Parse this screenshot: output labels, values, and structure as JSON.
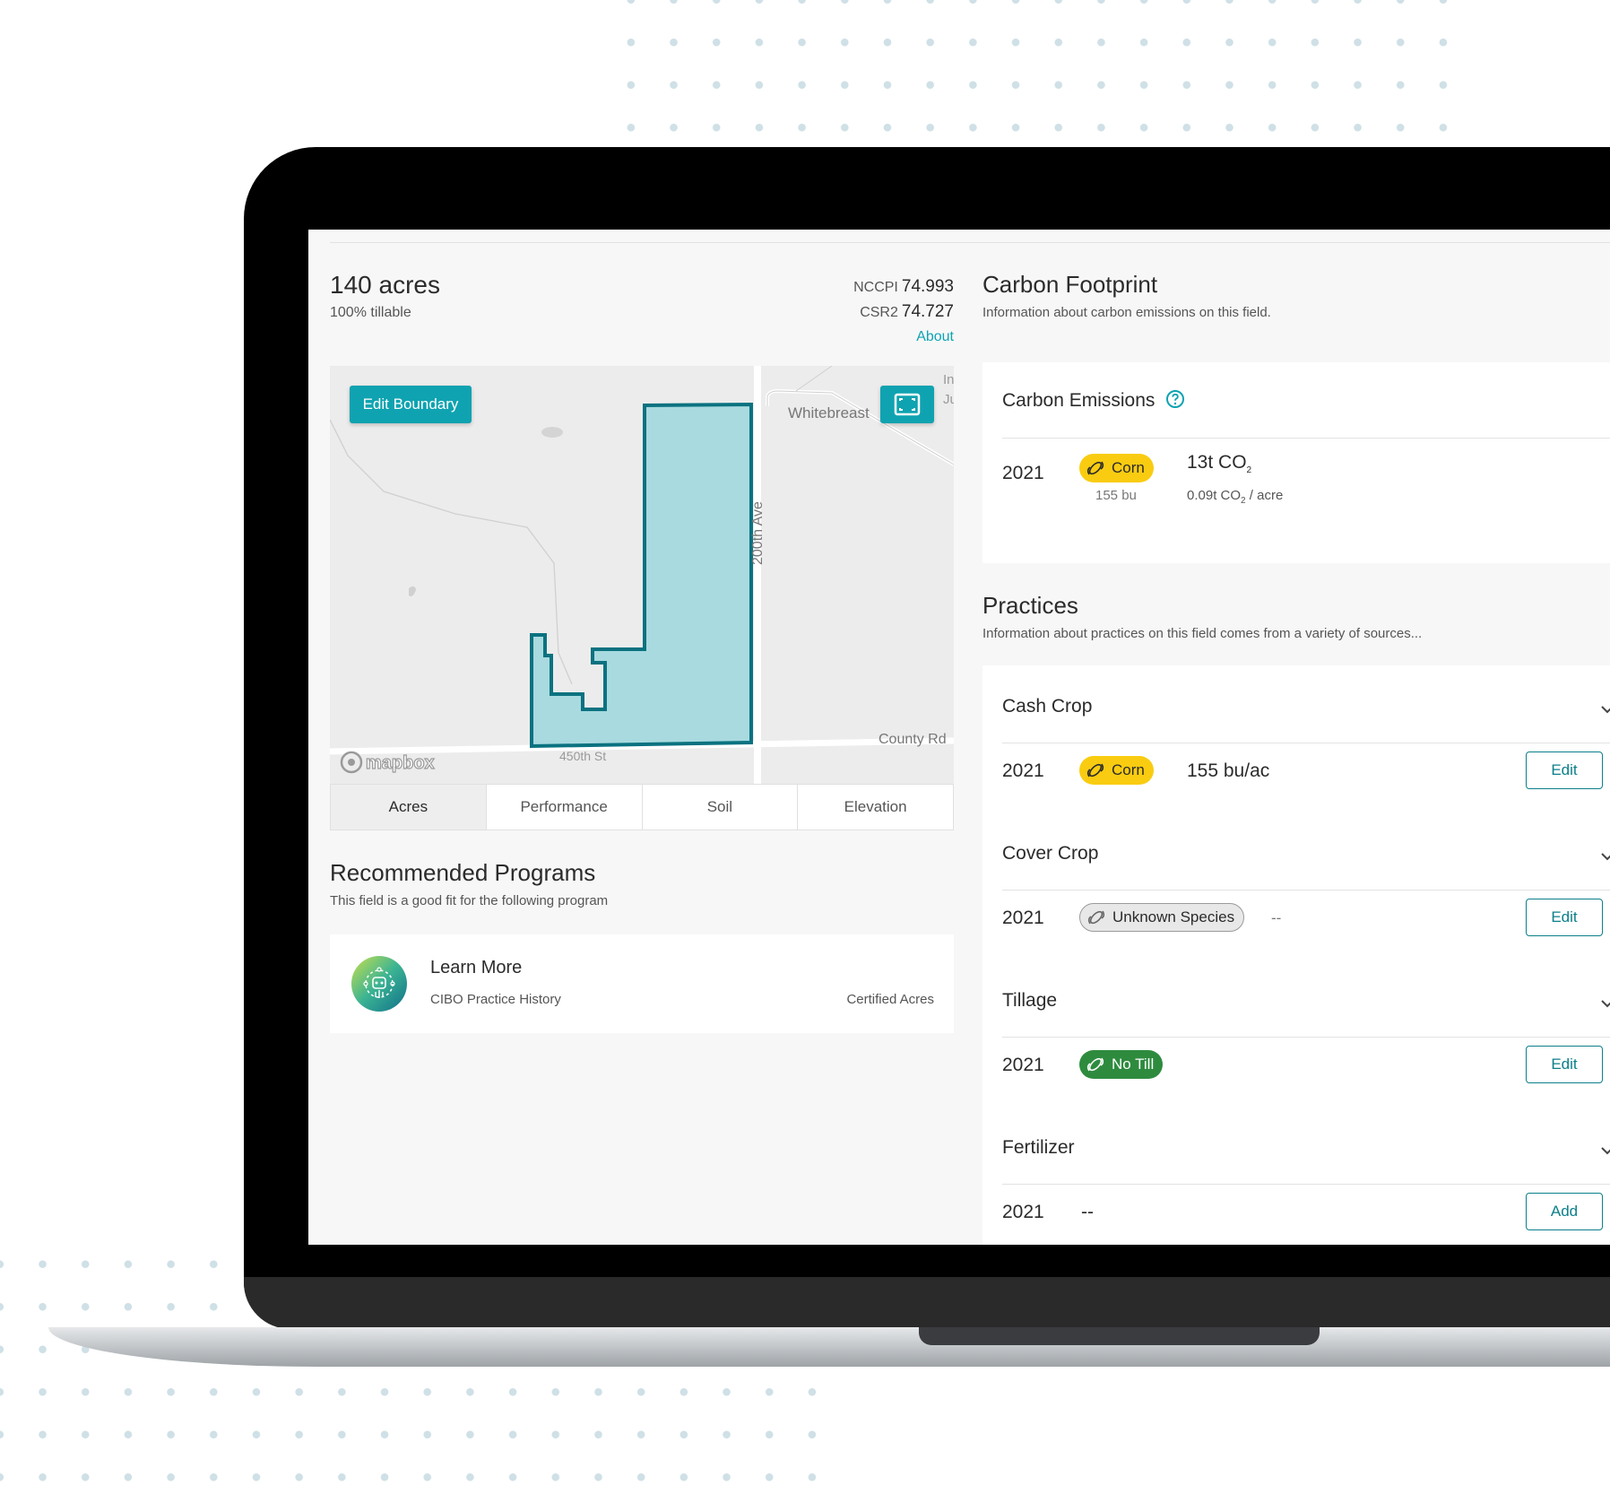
{
  "field": {
    "acres": "140 acres",
    "tillable": "100% tillable",
    "nccpi_label": "NCCPI",
    "nccpi_value": "74.993",
    "csr2_label": "CSR2",
    "csr2_value": "74.727",
    "about_link": "About"
  },
  "map": {
    "edit_boundary_label": "Edit Boundary",
    "road_whitebreast": "Whitebreast",
    "road_200th": "200th Ave",
    "road_county": "County Rd",
    "road_450th": "450th St",
    "road_in": "In",
    "road_ju": "Ju",
    "attribution": "mapbox",
    "fill_color": "#a8dadf",
    "stroke_color": "#0b7280"
  },
  "tabs": [
    {
      "label": "Acres",
      "active": true
    },
    {
      "label": "Performance",
      "active": false
    },
    {
      "label": "Soil",
      "active": false
    },
    {
      "label": "Elevation",
      "active": false
    }
  ],
  "recommended": {
    "title": "Recommended Programs",
    "subtitle": "This field is a good fit for the following program",
    "program": {
      "name": "Learn More",
      "subtitle": "CIBO Practice History",
      "tag": "Certified Acres"
    }
  },
  "carbon": {
    "title": "Carbon Footprint",
    "subtitle": "Information about carbon emissions on this field.",
    "emissions": {
      "heading": "Carbon Emissions",
      "year": "2021",
      "crop": "Corn",
      "yield": "155 bu",
      "total": "13t CO",
      "total_sub": "2",
      "per_acre": "0.09t CO",
      "per_acre_sub": "2",
      "per_acre_unit": "/ acre"
    }
  },
  "practices": {
    "title": "Practices",
    "subtitle": "Information about practices on this field comes from a variety of sources...",
    "items": [
      {
        "name": "Cash Crop",
        "year": "2021",
        "pill": "Corn",
        "value": "155 bu/ac",
        "action": "Edit"
      },
      {
        "name": "Cover Crop",
        "year": "2021",
        "pill": "Unknown Species",
        "value": "--",
        "action": "Edit"
      },
      {
        "name": "Tillage",
        "year": "2021",
        "pill": "No Till",
        "value": "",
        "action": "Edit"
      },
      {
        "name": "Fertilizer",
        "year": "2021",
        "pill": "",
        "value": "--",
        "action": "Add"
      }
    ]
  },
  "colors": {
    "accent": "#0fa3b1",
    "corn": "#f9cc11",
    "no_till": "#2e8b3e"
  }
}
